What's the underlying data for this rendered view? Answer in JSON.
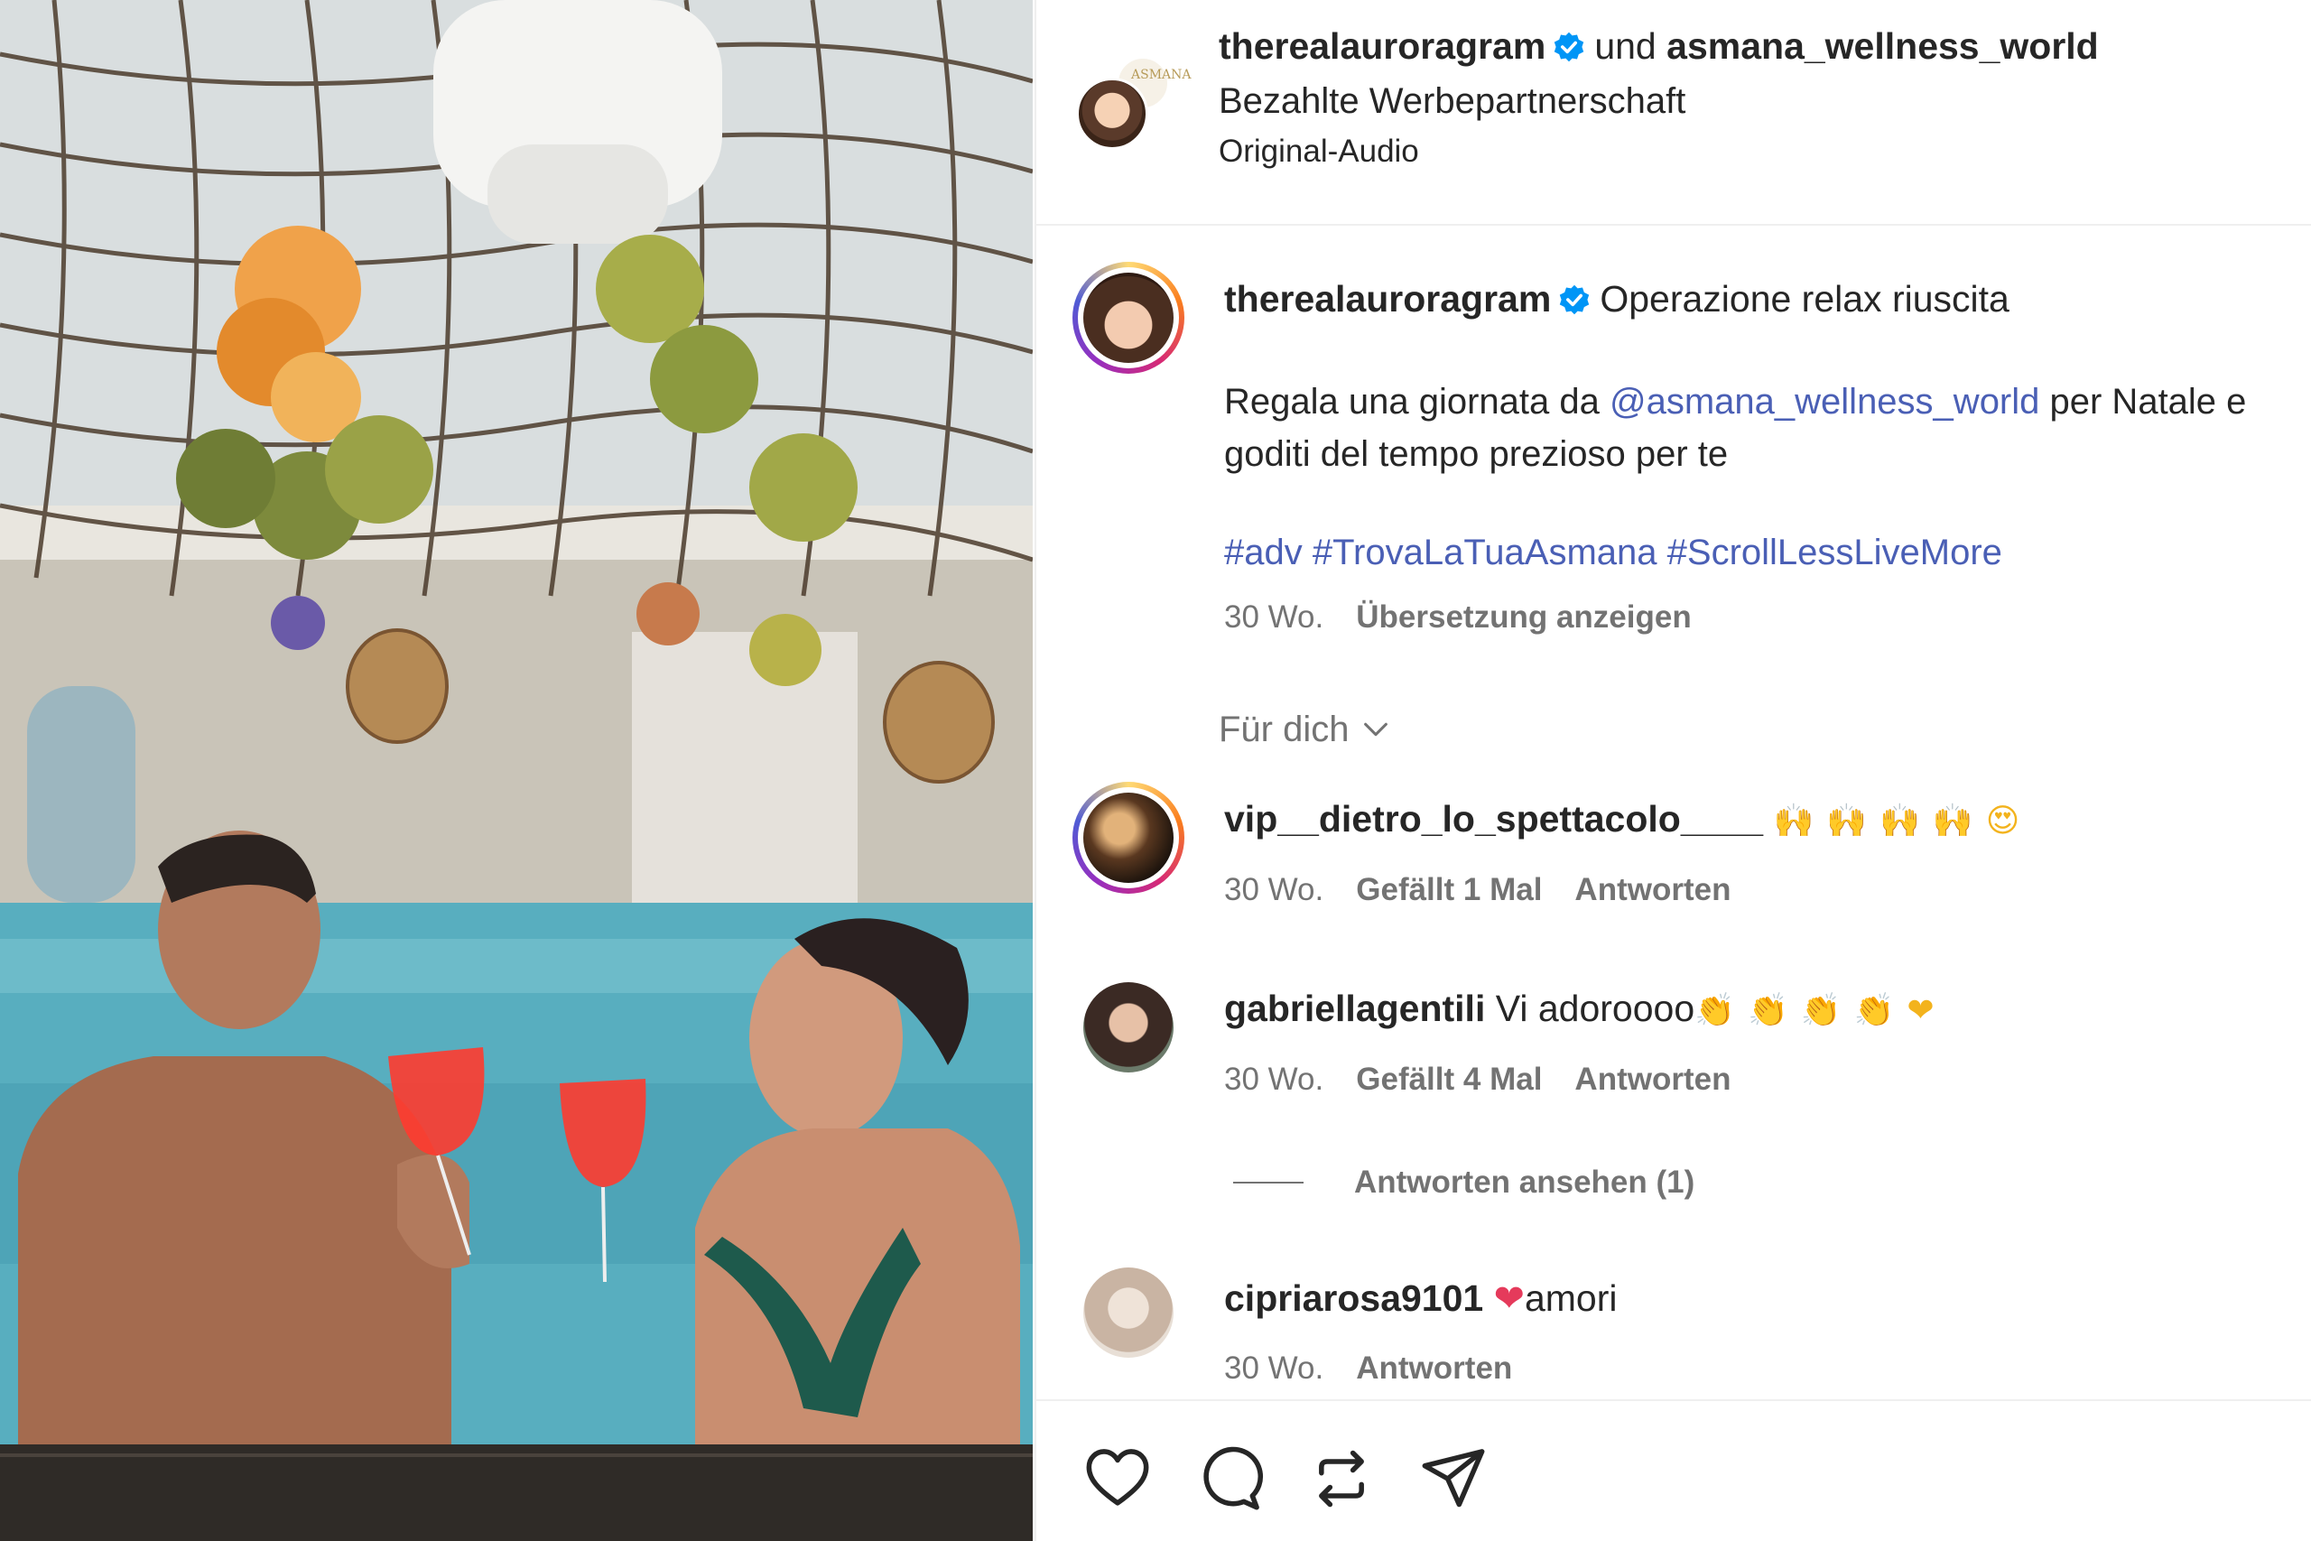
{
  "header": {
    "author": "therealauroragram",
    "conjunction": "und",
    "coauthor": "asmana_wellness_world",
    "paid_label": "Bezahlte Werbepartnerschaft",
    "audio_label": "Original-Audio"
  },
  "caption": {
    "username": "therealauroragram",
    "headline": "Operazione relax riuscita",
    "body_before": "Regala una giornata da ",
    "mention": "@asmana_wellness_world",
    "body_after": " per Natale e goditi del tempo prezioso per te",
    "hashtags": "#adv #TrovaLaTuaAsmana #ScrollLessLiveMore",
    "time": "30 Wo.",
    "translate": "Übersetzung anzeigen"
  },
  "sort_label": "Für dich",
  "comments": [
    {
      "username": "vip__dietro_lo_spettacolo____",
      "text": "",
      "emoji": "🙌🙌🙌🙌😍",
      "time": "30 Wo.",
      "likes": "Gefällt 1 Mal",
      "reply": "Antworten"
    },
    {
      "username": "gabriellagentili",
      "text": "Vi adoroooo",
      "emoji": "👏👏👏👏❤",
      "time": "30 Wo.",
      "likes": "Gefällt 4 Mal",
      "reply": "Antworten"
    },
    {
      "username": "cipriarosa9101",
      "text": "amori",
      "emoji": "❤",
      "time": "30 Wo.",
      "reply": "Antworten"
    }
  ],
  "view_replies": "Antworten ansehen (1)",
  "actions": [
    "heart-icon",
    "comment-icon",
    "repost-icon",
    "share-icon"
  ],
  "colors": {
    "link": "#4a5fb5",
    "muted": "#737373",
    "verified": "#0095f6"
  }
}
